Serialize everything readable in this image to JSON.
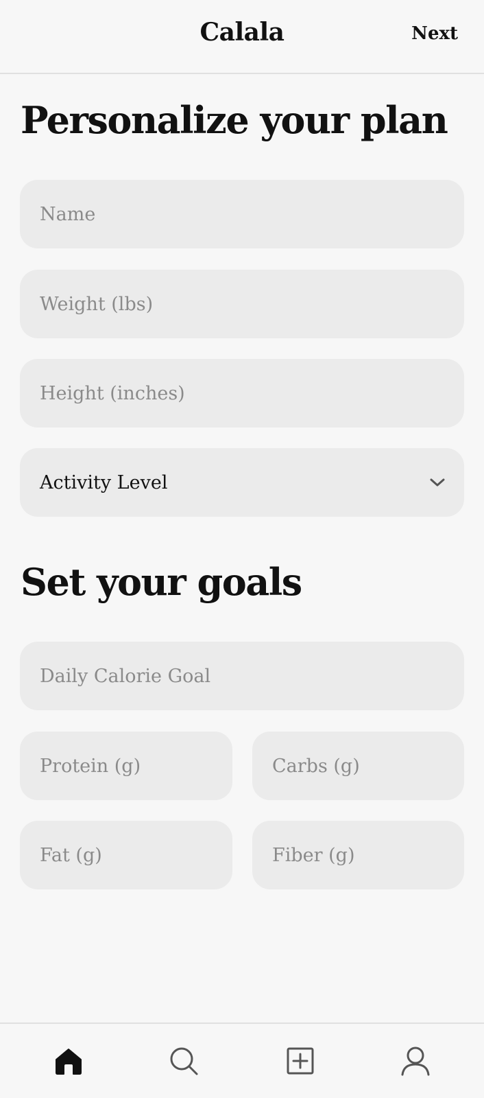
{
  "header": {
    "app_title": "Calala",
    "next_label": "Next"
  },
  "personalize": {
    "title": "Personalize your plan",
    "name_placeholder": "Name",
    "weight_placeholder": "Weight (lbs)",
    "height_placeholder": "Height (inches)",
    "activity_label": "Activity Level"
  },
  "goals": {
    "title": "Set your goals",
    "calorie_placeholder": "Daily Calorie Goal",
    "protein_placeholder": "Protein (g)",
    "carbs_placeholder": "Carbs (g)",
    "fat_placeholder": "Fat (g)",
    "fiber_placeholder": "Fiber (g)"
  },
  "nav": {
    "items": [
      {
        "icon": "home-icon",
        "active": true
      },
      {
        "icon": "search-icon",
        "active": false
      },
      {
        "icon": "add-square-icon",
        "active": false
      },
      {
        "icon": "profile-icon",
        "active": false
      }
    ]
  },
  "colors": {
    "background": "#f7f7f7",
    "field_background": "#ebebeb",
    "text": "#111111",
    "placeholder": "#8a8a8a",
    "icon_inactive": "#555555"
  }
}
